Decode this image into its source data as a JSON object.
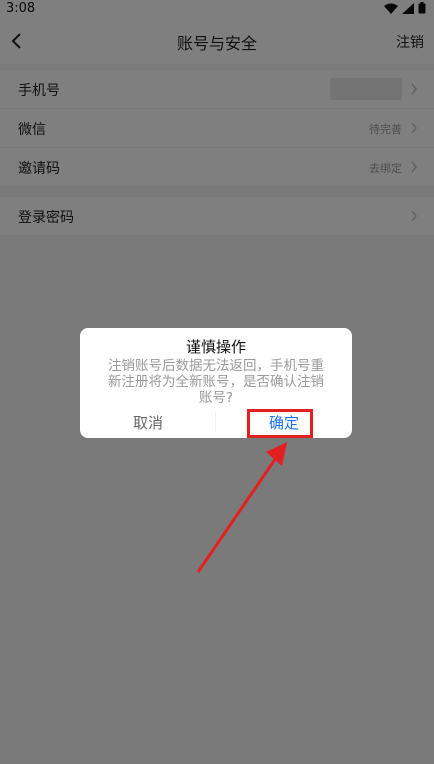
{
  "status": {
    "time": "3:08"
  },
  "nav": {
    "title": "账号与安全",
    "action": "注销"
  },
  "settings": [
    {
      "label": "手机号",
      "value": ""
    },
    {
      "label": "微信",
      "value": "待完善"
    },
    {
      "label": "邀请码",
      "value": "去绑定"
    },
    {
      "label": "登录密码",
      "value": ""
    }
  ],
  "dialog": {
    "title": "谨慎操作",
    "message": "注销账号后数据无法返回，手机号重新注册将为全新账号，是否确认注销账号?",
    "cancel": "取消",
    "confirm": "确定"
  },
  "colors": {
    "overlay": "rgba(0,0,0,0.5)",
    "highlight": "#e32020",
    "confirm": "#1a73e8"
  },
  "icons": [
    "wifi-icon",
    "signal-icon",
    "battery-icon",
    "back-arrow-icon",
    "chevron-right-icon"
  ]
}
